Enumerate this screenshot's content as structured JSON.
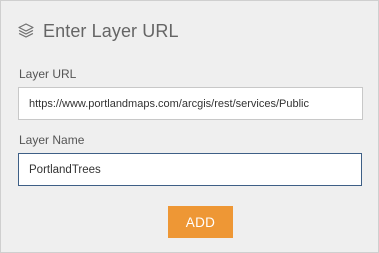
{
  "panel": {
    "title": "Enter Layer URL",
    "title_icon": "layers-icon"
  },
  "layer_url": {
    "label": "Layer URL",
    "value": "https://www.portlandmaps.com/arcgis/rest/services/Public"
  },
  "layer_name": {
    "label": "Layer Name",
    "value": "PortlandTrees"
  },
  "actions": {
    "add_label": "ADD"
  },
  "colors": {
    "panel_background": "#efefef",
    "accent_button": "#ee9735",
    "focus_border": "#3e5f86"
  }
}
